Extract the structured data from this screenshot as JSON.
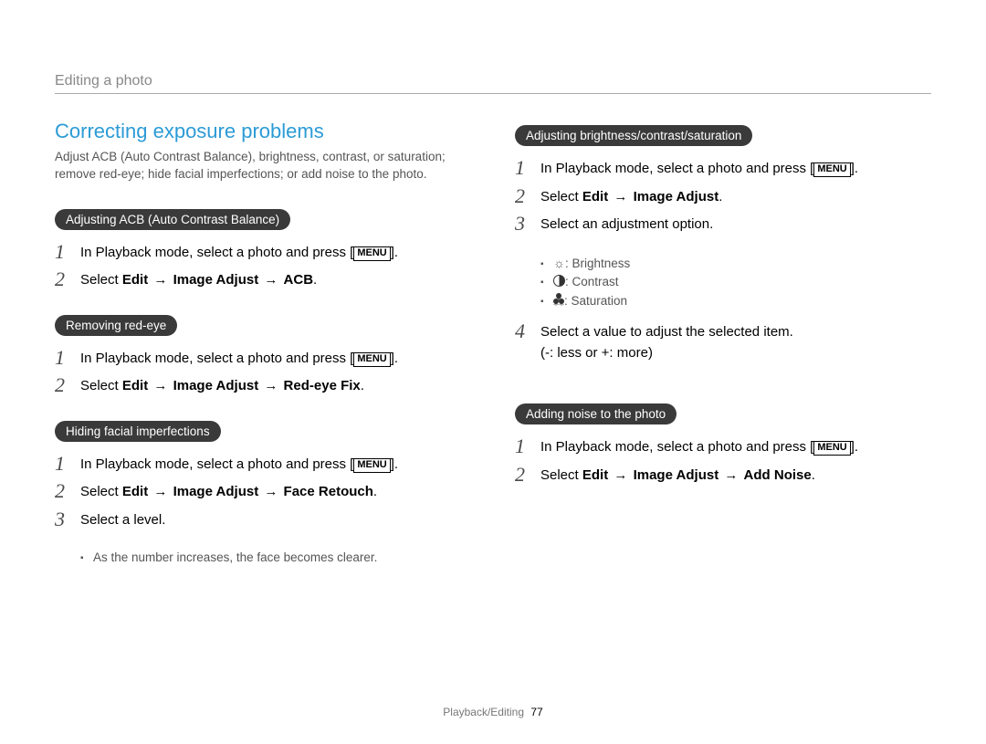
{
  "header": {
    "section": "Editing a photo"
  },
  "title": "Correcting exposure problems",
  "intro": "Adjust ACB (Auto Contrast Balance), brightness, contrast, or saturation; remove red-eye; hide facial imperfections; or add noise to the photo.",
  "labels": {
    "menu": "MENU",
    "arrow": "→",
    "select": "Select",
    "edit": "Edit",
    "image_adjust": "Image Adjust",
    "acb": "ACB",
    "redeye": "Red-eye Fix",
    "face_retouch": "Face Retouch",
    "add_noise": "Add Noise"
  },
  "sec_acb": {
    "pill": "Adjusting ACB (Auto Contrast Balance)",
    "step1_pre": "In Playback mode, select a photo and press [",
    "step1_post": "]."
  },
  "sec_redeye": {
    "pill": "Removing red-eye",
    "step1_pre": "In Playback mode, select a photo and press [",
    "step1_post": "]."
  },
  "sec_face": {
    "pill": "Hiding facial imperfections",
    "step1_pre": "In Playback mode, select a photo and press [",
    "step1_post": "].",
    "step3": "Select a level.",
    "note": "As the number increases, the face becomes clearer."
  },
  "sec_bcs": {
    "pill": "Adjusting brightness/contrast/saturation",
    "step1_pre": "In Playback mode, select a photo and press [",
    "step1_post": "].",
    "step3": "Select an adjustment option.",
    "opt_brightness": ": Brightness",
    "opt_contrast": ": Contrast",
    "opt_saturation": ": Saturation",
    "step4a": "Select a value to adjust the selected item.",
    "step4b": "(-: less or +: more)"
  },
  "sec_noise": {
    "pill": "Adding noise to the photo",
    "step1_pre": "In Playback mode, select a photo and press [",
    "step1_post": "]."
  },
  "footer": {
    "section": "Playback/Editing",
    "page": "77"
  }
}
